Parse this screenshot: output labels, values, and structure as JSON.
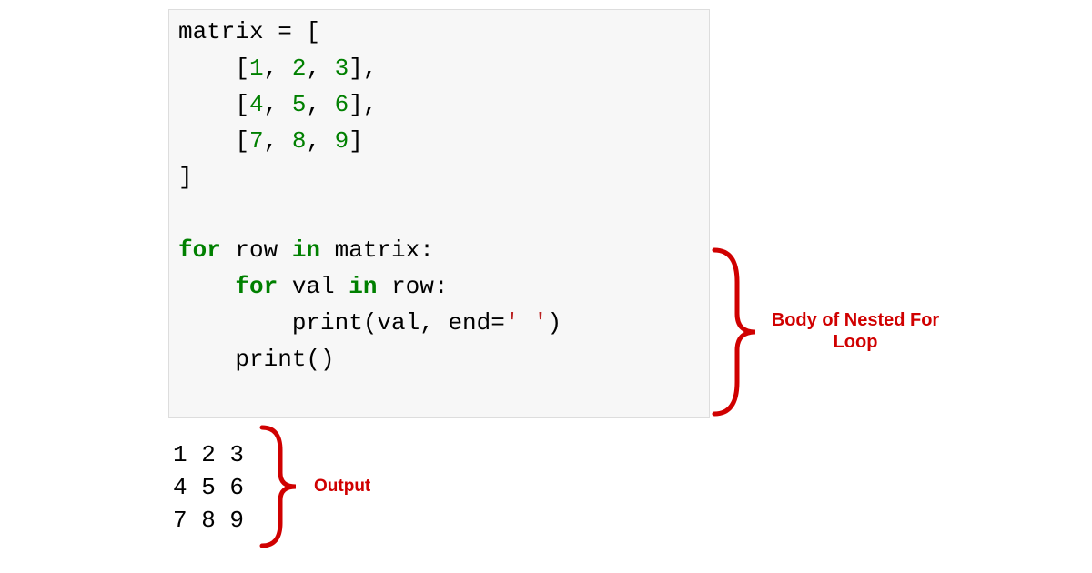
{
  "code": {
    "l1": "matrix = [",
    "l2_a": "    [",
    "l2_b": "1",
    "l2_c": ", ",
    "l2_d": "2",
    "l2_e": ", ",
    "l2_f": "3",
    "l2_g": "],",
    "l3_a": "    [",
    "l3_b": "4",
    "l3_c": ", ",
    "l3_d": "5",
    "l3_e": ", ",
    "l3_f": "6",
    "l3_g": "],",
    "l4_a": "    [",
    "l4_b": "7",
    "l4_c": ", ",
    "l4_d": "8",
    "l4_e": ", ",
    "l4_f": "9",
    "l4_g": "]",
    "l5": "]",
    "l6": "",
    "l7_a": "for",
    "l7_b": " row ",
    "l7_c": "in",
    "l7_d": " matrix:",
    "l8_a": "    ",
    "l8_b": "for",
    "l8_c": " val ",
    "l8_d": "in",
    "l8_e": " row:",
    "l9_a": "        print(val, end=",
    "l9_b": "' '",
    "l9_c": ")",
    "l10": "    print()"
  },
  "output": {
    "l1": "1 2 3",
    "l2": "4 5 6",
    "l3": "7 8 9"
  },
  "annotations": {
    "body": "Body of Nested For\nLoop",
    "body_l1": "Body of Nested For",
    "body_l2": "Loop",
    "output": "Output"
  }
}
